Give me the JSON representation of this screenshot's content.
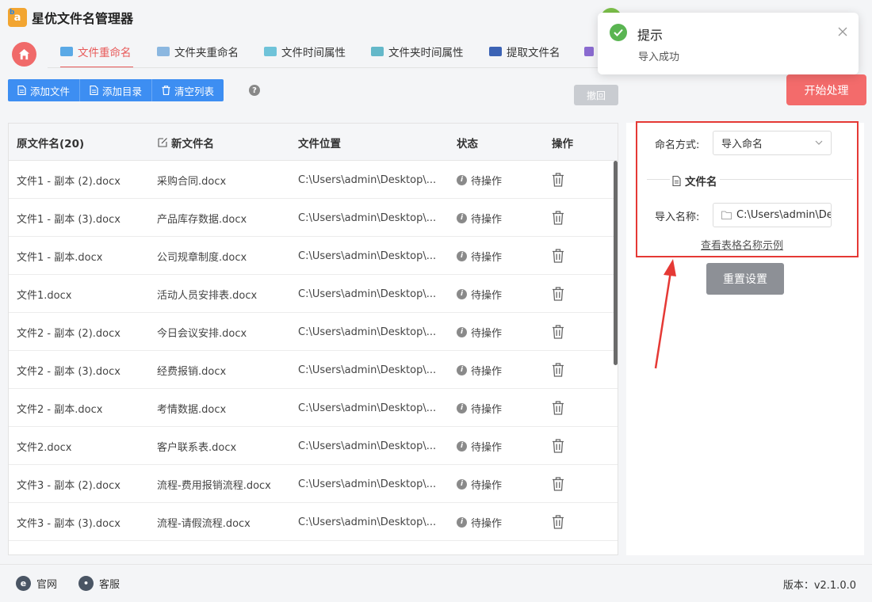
{
  "app": {
    "title": "星优文件名管理器",
    "logo_text": "a",
    "logo_sub": "b"
  },
  "tabs": [
    {
      "label": "文件重命名",
      "active": true
    },
    {
      "label": "文件夹重命名",
      "active": false
    },
    {
      "label": "文件时间属性",
      "active": false
    },
    {
      "label": "文件夹时间属性",
      "active": false
    },
    {
      "label": "提取文件名",
      "active": false
    }
  ],
  "toolbar": {
    "add_file": "添加文件",
    "add_dir": "添加目录",
    "clear_list": "清空列表",
    "help": "?",
    "undo": "撤回",
    "start": "开始处理"
  },
  "table": {
    "headers": {
      "original": "原文件名(20)",
      "new": "新文件名",
      "location": "文件位置",
      "status": "状态",
      "action": "操作"
    },
    "rows": [
      {
        "original": "文件1 - 副本 (2).docx",
        "new": "采购合同.docx",
        "location": "C:\\Users\\admin\\Desktop\\...",
        "status": "待操作"
      },
      {
        "original": "文件1 - 副本 (3).docx",
        "new": "产品库存数据.docx",
        "location": "C:\\Users\\admin\\Desktop\\...",
        "status": "待操作"
      },
      {
        "original": "文件1 - 副本.docx",
        "new": "公司规章制度.docx",
        "location": "C:\\Users\\admin\\Desktop\\...",
        "status": "待操作"
      },
      {
        "original": "文件1.docx",
        "new": "活动人员安排表.docx",
        "location": "C:\\Users\\admin\\Desktop\\...",
        "status": "待操作"
      },
      {
        "original": "文件2 - 副本 (2).docx",
        "new": "今日会议安排.docx",
        "location": "C:\\Users\\admin\\Desktop\\...",
        "status": "待操作"
      },
      {
        "original": "文件2 - 副本 (3).docx",
        "new": "经费报销.docx",
        "location": "C:\\Users\\admin\\Desktop\\...",
        "status": "待操作"
      },
      {
        "original": "文件2 - 副本.docx",
        "new": "考情数据.docx",
        "location": "C:\\Users\\admin\\Desktop\\...",
        "status": "待操作"
      },
      {
        "original": "文件2.docx",
        "new": "客户联系表.docx",
        "location": "C:\\Users\\admin\\Desktop\\...",
        "status": "待操作"
      },
      {
        "original": "文件3 - 副本 (2).docx",
        "new": "流程-费用报销流程.docx",
        "location": "C:\\Users\\admin\\Desktop\\...",
        "status": "待操作"
      },
      {
        "original": "文件3 - 副本 (3).docx",
        "new": "流程-请假流程.docx",
        "location": "C:\\Users\\admin\\Desktop\\...",
        "status": "待操作"
      }
    ]
  },
  "panel": {
    "naming_label": "命名方式:",
    "naming_value": "导入命名",
    "section_title": "文件名",
    "import_label": "导入名称:",
    "import_value": "C:\\Users\\admin\\De",
    "example_link": "查看表格名称示例",
    "reset": "重置设置"
  },
  "toast": {
    "title": "提示",
    "message": "导入成功"
  },
  "footer": {
    "website": "官网",
    "support": "客服",
    "version": "版本：v2.1.0.0"
  },
  "colors": {
    "accent_red": "#e85a5a",
    "primary_blue": "#3d8ef2",
    "success_green": "#5ab552",
    "highlight_box": "#e53935"
  }
}
